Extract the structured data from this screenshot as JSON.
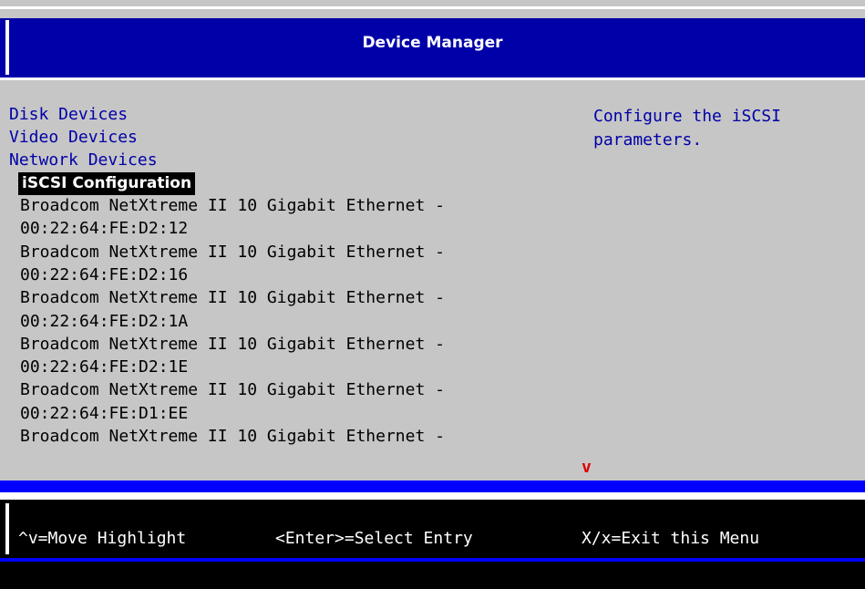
{
  "header": {
    "title": "Device Manager"
  },
  "menu": {
    "categories": [
      {
        "label": "Disk Devices"
      },
      {
        "label": "Video Devices"
      },
      {
        "label": "Network Devices"
      }
    ],
    "selected_entry": "iSCSI Configuration",
    "devices": [
      "Broadcom NetXtreme II 10 Gigabit Ethernet -",
      "00:22:64:FE:D2:12",
      "Broadcom NetXtreme II 10 Gigabit Ethernet -",
      "00:22:64:FE:D2:16",
      "Broadcom NetXtreme II 10 Gigabit Ethernet -",
      "00:22:64:FE:D2:1A",
      "Broadcom NetXtreme II 10 Gigabit Ethernet -",
      "00:22:64:FE:D2:1E",
      "Broadcom NetXtreme II 10 Gigabit Ethernet -",
      "00:22:64:FE:D1:EE",
      "Broadcom NetXtreme II 10 Gigabit Ethernet -"
    ],
    "more_indicator": "v"
  },
  "help": {
    "text": "Configure the iSCSI\nparameters."
  },
  "footer": {
    "move": "^v=Move Highlight",
    "select": "<Enter>=Select Entry",
    "exit": "X/x=Exit this Menu"
  },
  "colors": {
    "menu_text": "#0000a8",
    "header_bg": "#0000a8",
    "screen_bg": "#c6c6c6",
    "highlight_bg": "#000000",
    "more_arrow": "#e00000"
  }
}
